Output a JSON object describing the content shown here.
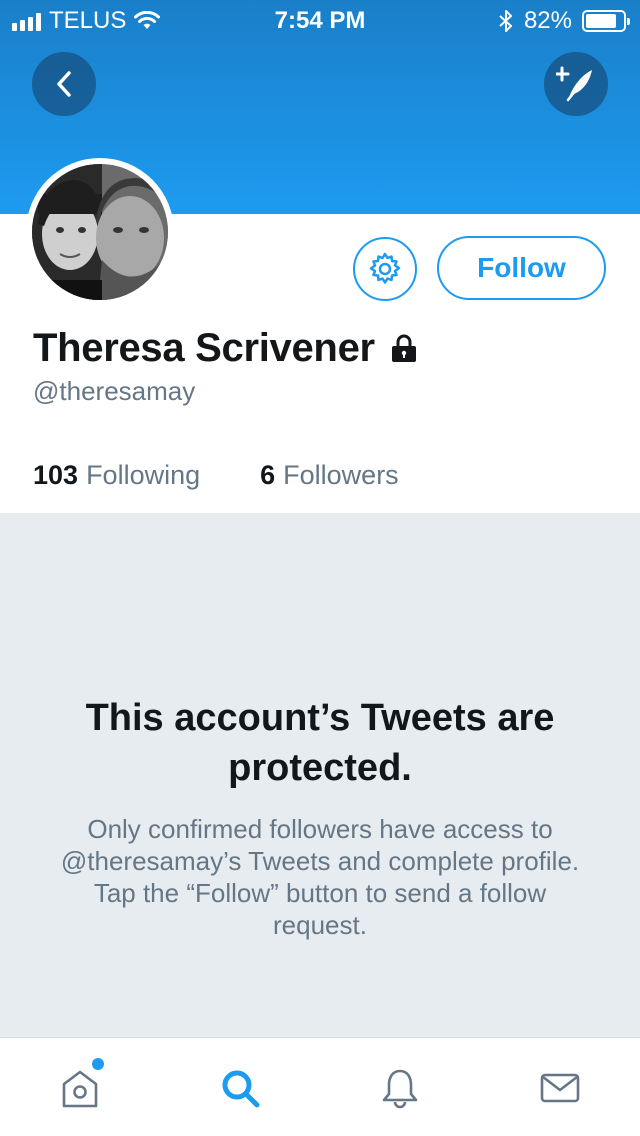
{
  "status_bar": {
    "carrier": "TELUS",
    "time": "7:54 PM",
    "battery": "82%",
    "battery_level": 0.82
  },
  "header": {
    "back_icon": "chevron-left-icon",
    "compose_icon": "compose-tweet-icon"
  },
  "profile": {
    "display_name": "Theresa Scrivener",
    "handle": "@theresamay",
    "locked_icon": "lock-icon",
    "settings_icon": "gear-icon",
    "follow_label": "Follow",
    "following_count": "103",
    "following_label": "Following",
    "followers_count": "6",
    "followers_label": "Followers"
  },
  "protected": {
    "title": "This account’s Tweets are protected.",
    "body": "Only confirmed followers have access to @theresamay’s Tweets and complete profile. Tap the “Follow” button to send a follow request."
  },
  "tabs": [
    {
      "name": "home",
      "icon": "home-icon",
      "has_badge": true
    },
    {
      "name": "search",
      "icon": "search-icon",
      "active": true
    },
    {
      "name": "notifications",
      "icon": "bell-icon"
    },
    {
      "name": "messages",
      "icon": "mail-icon"
    }
  ],
  "colors": {
    "accent": "#1d9bf0",
    "banner_top": "#1a7fc9",
    "protected_bg": "#e6ecf0",
    "secondary_text": "#657786"
  }
}
